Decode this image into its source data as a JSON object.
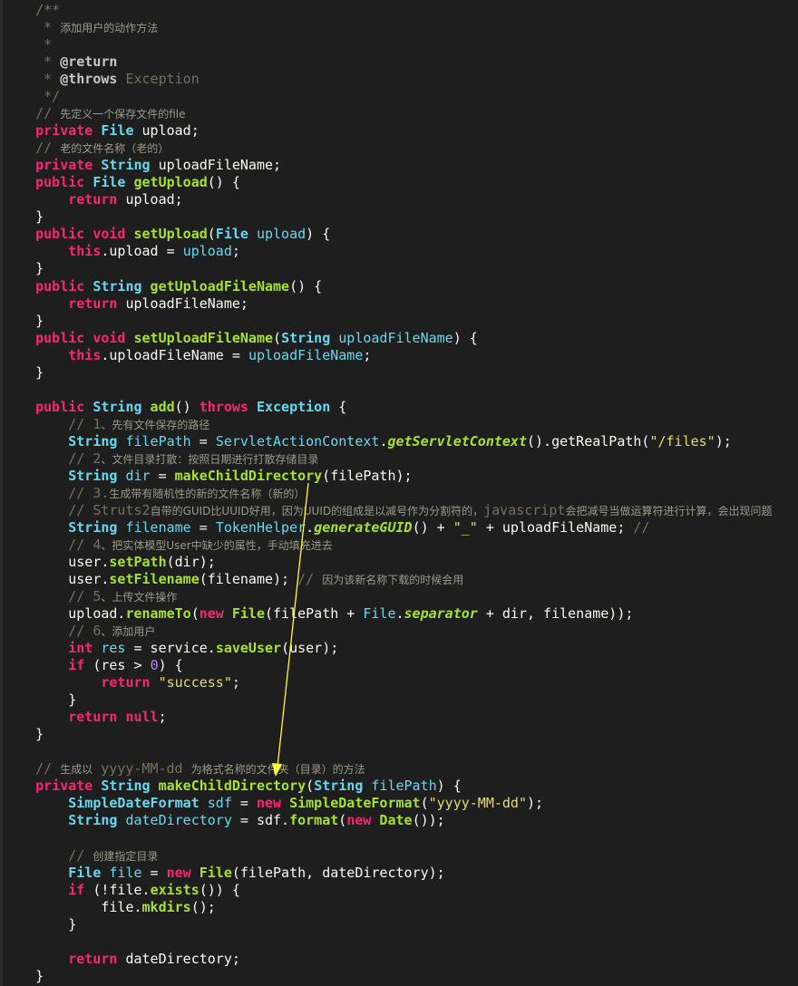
{
  "annotation": {
    "color": "#ffff33",
    "description": "yellow-arrow"
  },
  "lines": [
    [
      [
        "cmt",
        "    /**"
      ]
    ],
    [
      [
        "cmt",
        "     * "
      ],
      [
        "cmt-cn",
        "添加用户的动作方法"
      ]
    ],
    [
      [
        "cmt",
        "     *"
      ]
    ],
    [
      [
        "cmt",
        "     * "
      ],
      [
        "ann",
        "@return"
      ]
    ],
    [
      [
        "cmt",
        "     * "
      ],
      [
        "ann",
        "@throws"
      ],
      [
        "cmt",
        " Exception"
      ]
    ],
    [
      [
        "cmt",
        "     */"
      ]
    ],
    [
      [
        "cmt",
        "    // "
      ],
      [
        "cmt-cn",
        "先定义一个保存文件的file"
      ]
    ],
    [
      [
        "kw",
        "    private"
      ],
      [
        "",
        ""
      ],
      [
        "",
        ""
      ],
      [
        "",
        ""
      ],
      [
        "ty",
        " File"
      ],
      [
        "",
        ""
      ],
      [
        "pl",
        " upload;"
      ]
    ],
    [
      [
        "cmt",
        "    // "
      ],
      [
        "cmt-cn",
        "老的文件名称（老的）"
      ]
    ],
    [
      [
        "kw",
        "    private"
      ],
      [
        "ty",
        " String"
      ],
      [
        "pl",
        " uploadFileName;"
      ]
    ],
    [
      [
        "kw",
        "    public"
      ],
      [
        "ty",
        " File"
      ],
      [
        "fn",
        " getUpload"
      ],
      [
        "pl",
        "() {"
      ]
    ],
    [
      [
        "kw",
        "        return"
      ],
      [
        "pl",
        " upload;"
      ]
    ],
    [
      [
        "pl",
        "    }"
      ]
    ],
    [
      [
        "kw",
        "    public void"
      ],
      [
        "fn",
        " setUpload"
      ],
      [
        "pl",
        "("
      ],
      [
        "ty",
        "File"
      ],
      [
        "fld",
        " upload"
      ],
      [
        "pl",
        ") {"
      ]
    ],
    [
      [
        "kw",
        "        this"
      ],
      [
        "pl",
        ".upload = "
      ],
      [
        "fld",
        "upload"
      ],
      [
        "pl",
        ";"
      ]
    ],
    [
      [
        "pl",
        "    }"
      ]
    ],
    [
      [
        "kw",
        "    public"
      ],
      [
        "ty",
        " String"
      ],
      [
        "fn",
        " getUploadFileName"
      ],
      [
        "pl",
        "() {"
      ]
    ],
    [
      [
        "kw",
        "        return"
      ],
      [
        "pl",
        " uploadFileName;"
      ]
    ],
    [
      [
        "pl",
        "    }"
      ]
    ],
    [
      [
        "kw",
        "    public void"
      ],
      [
        "fn",
        " setUploadFileName"
      ],
      [
        "pl",
        "("
      ],
      [
        "ty",
        "String"
      ],
      [
        "fld",
        " uploadFileName"
      ],
      [
        "pl",
        ") {"
      ]
    ],
    [
      [
        "kw",
        "        this"
      ],
      [
        "pl",
        ".uploadFileName = "
      ],
      [
        "fld",
        "uploadFileName"
      ],
      [
        "pl",
        ";"
      ]
    ],
    [
      [
        "pl",
        "    }"
      ]
    ],
    [
      [
        "pl",
        ""
      ]
    ],
    [
      [
        "kw",
        "    public"
      ],
      [
        "ty",
        " String"
      ],
      [
        "fn",
        " add"
      ],
      [
        "pl",
        "() "
      ],
      [
        "kw",
        "throws"
      ],
      [
        "ty",
        " Exception"
      ],
      [
        "pl",
        " {"
      ]
    ],
    [
      [
        "cmt",
        "        // 1"
      ],
      [
        "cmt-cn",
        "、先有文件保存的路径"
      ]
    ],
    [
      [
        "ty",
        "        String"
      ],
      [
        "fld",
        " filePath"
      ],
      [
        "pl",
        " = "
      ],
      [
        "fld",
        "ServletActionContext"
      ],
      [
        "pl",
        "."
      ],
      [
        "fn ital",
        "getServletContext"
      ],
      [
        "pl",
        "().getRealPath("
      ],
      [
        "str",
        "\"/files\""
      ],
      [
        "pl",
        ");"
      ]
    ],
    [
      [
        "cmt",
        "        // 2"
      ],
      [
        "cmt-cn",
        "、文件目录打散：按照日期进行打散存储目录"
      ]
    ],
    [
      [
        "ty",
        "        String"
      ],
      [
        "fld",
        " dir"
      ],
      [
        "pl",
        " = "
      ],
      [
        "fn",
        "makeChildDirectory"
      ],
      [
        "pl",
        "(filePath);"
      ]
    ],
    [
      [
        "cmt",
        "        // 3."
      ],
      [
        "cmt-cn",
        "生成带有随机性的新的文件名称（新的）"
      ]
    ],
    [
      [
        "cmt",
        "        // Struts2"
      ],
      [
        "cmt-cn",
        "自带的GUID比UUID好用，因为UUID的组成是以减号作为分割符的，"
      ],
      [
        "cmt",
        "javascript"
      ],
      [
        "cmt-cn",
        "会把减号当做运算符进行计算，会出现问题"
      ]
    ],
    [
      [
        "ty",
        "        String"
      ],
      [
        "fld",
        " filename"
      ],
      [
        "pl",
        " = "
      ],
      [
        "fld",
        "TokenHelper"
      ],
      [
        "pl",
        "."
      ],
      [
        "fn ital",
        "generateGUID"
      ],
      [
        "pl",
        "() + "
      ],
      [
        "str",
        "\"_\""
      ],
      [
        "pl",
        " + uploadFileName; "
      ],
      [
        "cmt",
        "//"
      ]
    ],
    [
      [
        "cmt",
        "        // 4"
      ],
      [
        "cmt-cn",
        "、把实体模型User中缺少的属性，手动填充进去"
      ]
    ],
    [
      [
        "pl",
        "        user."
      ],
      [
        "fn",
        "setPath"
      ],
      [
        "pl",
        "(dir);"
      ]
    ],
    [
      [
        "pl",
        "        user."
      ],
      [
        "fn",
        "setFilename"
      ],
      [
        "pl",
        "(filename); "
      ],
      [
        "cmt",
        "// "
      ],
      [
        "cmt-cn",
        "因为该新名称下载的时候会用"
      ]
    ],
    [
      [
        "cmt",
        "        // 5"
      ],
      [
        "cmt-cn",
        "、上传文件操作"
      ]
    ],
    [
      [
        "pl",
        "        upload."
      ],
      [
        "fn",
        "renameTo"
      ],
      [
        "pl",
        "("
      ],
      [
        "kw",
        "new"
      ],
      [
        "fn",
        " File"
      ],
      [
        "pl",
        "(filePath + "
      ],
      [
        "fld",
        "File"
      ],
      [
        "pl",
        "."
      ],
      [
        "fn ital",
        "separator"
      ],
      [
        "pl",
        " + dir, filename));"
      ]
    ],
    [
      [
        "cmt",
        "        // 6"
      ],
      [
        "cmt-cn",
        "、添加用户"
      ]
    ],
    [
      [
        "kw",
        "        int"
      ],
      [
        "fld",
        " res"
      ],
      [
        "pl",
        " = service."
      ],
      [
        "fn",
        "saveUser"
      ],
      [
        "pl",
        "(user);"
      ]
    ],
    [
      [
        "kw",
        "        if"
      ],
      [
        "pl",
        " (res > "
      ],
      [
        "num",
        "0"
      ],
      [
        "pl",
        ") {"
      ]
    ],
    [
      [
        "kw",
        "            return"
      ],
      [
        "str",
        " \"success\""
      ],
      [
        "pl",
        ";"
      ]
    ],
    [
      [
        "pl",
        "        }"
      ]
    ],
    [
      [
        "kw",
        "        return null"
      ],
      [
        "pl",
        ";"
      ]
    ],
    [
      [
        "pl",
        "    }"
      ]
    ],
    [
      [
        "pl",
        ""
      ]
    ],
    [
      [
        "cmt",
        "    // "
      ],
      [
        "cmt-cn",
        "生成以"
      ],
      [
        "cmt",
        " yyyy-MM-dd "
      ],
      [
        "cmt-cn",
        "为格式名称的文件夹（目录）的方法"
      ]
    ],
    [
      [
        "kw",
        "    private"
      ],
      [
        "ty",
        " String"
      ],
      [
        "fn",
        " makeChildDirectory"
      ],
      [
        "pl",
        "("
      ],
      [
        "ty",
        "String"
      ],
      [
        "fld",
        " filePath"
      ],
      [
        "pl",
        ") {"
      ]
    ],
    [
      [
        "ty",
        "        SimpleDateFormat"
      ],
      [
        "fld",
        " sdf"
      ],
      [
        "pl",
        " = "
      ],
      [
        "kw",
        "new"
      ],
      [
        "fn",
        " SimpleDateFormat"
      ],
      [
        "pl",
        "("
      ],
      [
        "str",
        "\"yyyy-MM-dd\""
      ],
      [
        "pl",
        ");"
      ]
    ],
    [
      [
        "ty",
        "        String"
      ],
      [
        "fld",
        " dateDirectory"
      ],
      [
        "pl",
        " = sdf."
      ],
      [
        "fn",
        "format"
      ],
      [
        "pl",
        "("
      ],
      [
        "kw",
        "new"
      ],
      [
        "fn",
        " Date"
      ],
      [
        "pl",
        "());"
      ]
    ],
    [
      [
        "pl",
        ""
      ]
    ],
    [
      [
        "cmt",
        "        // "
      ],
      [
        "cmt-cn",
        "创建指定目录"
      ]
    ],
    [
      [
        "ty",
        "        File"
      ],
      [
        "fld",
        " file"
      ],
      [
        "pl",
        " = "
      ],
      [
        "kw",
        "new"
      ],
      [
        "fn",
        " File"
      ],
      [
        "pl",
        "(filePath, dateDirectory);"
      ]
    ],
    [
      [
        "kw",
        "        if"
      ],
      [
        "pl",
        " (!file."
      ],
      [
        "fn",
        "exists"
      ],
      [
        "pl",
        "()) {"
      ]
    ],
    [
      [
        "pl",
        "            file."
      ],
      [
        "fn",
        "mkdirs"
      ],
      [
        "pl",
        "();"
      ]
    ],
    [
      [
        "pl",
        "        }"
      ]
    ],
    [
      [
        "pl",
        ""
      ]
    ],
    [
      [
        "kw",
        "        return"
      ],
      [
        "pl",
        " dateDirectory;"
      ]
    ],
    [
      [
        "pl",
        "    }"
      ]
    ]
  ]
}
